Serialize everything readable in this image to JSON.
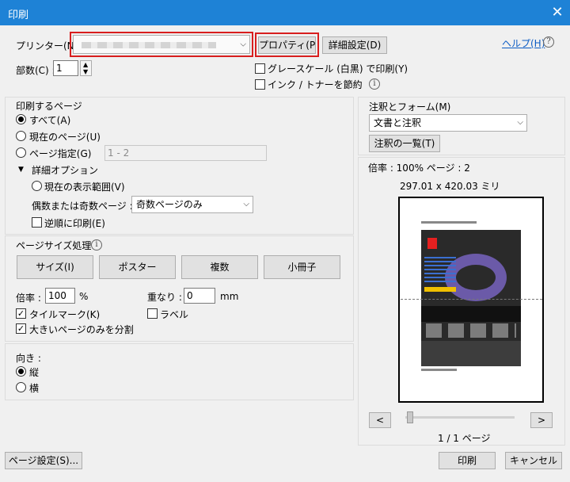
{
  "window": {
    "title": "印刷",
    "close_glyph": "✕"
  },
  "printer": {
    "label": "プリンター(N) :",
    "selected": "",
    "properties_button": "プロパティ(P)",
    "advanced_button": "詳細設定(D)",
    "help_link": "ヘルプ(H)",
    "help_glyph": "?"
  },
  "copies": {
    "label": "部数(C) :",
    "value": "1"
  },
  "grayscale": {
    "label": "グレースケール (白黒) で印刷(Y)",
    "checked": false
  },
  "save_ink": {
    "label": "インク / トナーを節約",
    "checked": false
  },
  "pages_to_print": {
    "heading": "印刷するページ",
    "all_label": "すべて(A)",
    "current_label": "現在のページ(U)",
    "specified_label": "ページ指定(G)",
    "range_placeholder": "1 - 2",
    "more_options_label": "詳細オプション",
    "current_view_label": "現在の表示範囲(V)",
    "odd_even_label": "偶数または奇数ページ :",
    "odd_even_value": "奇数ページのみ",
    "reverse_label": "逆順に印刷(E)",
    "selected": "all"
  },
  "page_sizing": {
    "heading": "ページサイズ処理",
    "buttons": [
      "サイズ(I)",
      "ポスター",
      "複数",
      "小冊子"
    ],
    "scale_label": "倍率 :",
    "scale_value": "100",
    "scale_unit": "%",
    "overlap_label": "重なり :",
    "overlap_value": "0",
    "overlap_unit": "mm",
    "tile_marks_label": "タイルマーク(K)",
    "tile_marks_checked": true,
    "labels_label": "ラベル",
    "labels_checked": false,
    "large_only_label": "大きいページのみを分割",
    "large_only_checked": true
  },
  "orientation": {
    "heading": "向き :",
    "portrait_label": "縦",
    "landscape_label": "横",
    "selected": "portrait"
  },
  "comments_forms": {
    "heading": "注釈とフォーム(M)",
    "value": "文書と注釈",
    "summarize_button": "注釈の一覧(T)"
  },
  "preview": {
    "scale_text": "倍率 : 100% ページ : 2",
    "dimensions": "297.01 x 420.03 ミリ",
    "prev_button": "<",
    "next_button": ">",
    "page_counter": "1 / 1 ページ"
  },
  "footer": {
    "page_setup_button": "ページ設定(S)...",
    "print_button": "印刷",
    "cancel_button": "キャンセル"
  },
  "colors": {
    "titlebar": "#1e82d6",
    "highlight_box": "#d81e1e"
  }
}
